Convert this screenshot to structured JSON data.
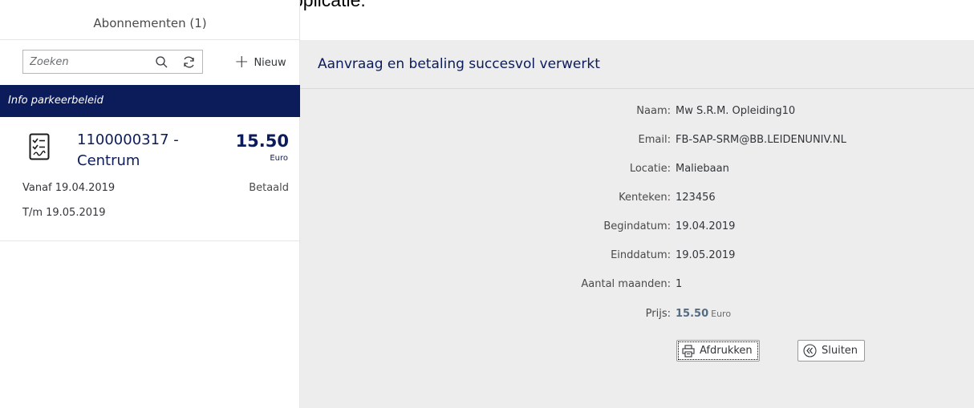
{
  "caption": "Na betaling komt men terug in de applicatie.",
  "master": {
    "title": "Abonnementen (1)",
    "search_placeholder": "Zoeken",
    "new_label": "Nieuw",
    "info_label": "Info parkeerbeleid",
    "items": [
      {
        "title_line1": "1100000317 -",
        "title_line2": "Centrum",
        "amount": "15.50",
        "unit": "Euro",
        "from": "Vanaf 19.04.2019",
        "to": "T/m 19.05.2019",
        "status": "Betaald"
      }
    ]
  },
  "detail": {
    "title": "Aanvraag en betaling succesvol verwerkt",
    "fields": [
      {
        "label": "Naam:",
        "value": "Mw S.R.M. Opleiding10"
      },
      {
        "label": "Email:",
        "value": "FB-SAP-SRM@BB.LEIDENUNIV.NL"
      },
      {
        "label": "Locatie:",
        "value": "Maliebaan"
      },
      {
        "label": "Kenteken:",
        "value": "123456"
      },
      {
        "label": "Begindatum:",
        "value": "19.04.2019"
      },
      {
        "label": "Einddatum:",
        "value": "19.05.2019"
      },
      {
        "label": "Aantal maanden:",
        "value": "1"
      }
    ],
    "price_label": "Prijs:",
    "price_value": "15.50",
    "price_unit": "Euro",
    "print_label": "Afdrukken",
    "close_label": "Sluiten"
  },
  "colors": {
    "brand_navy": "#0c1c5b",
    "detail_background": "#ededed"
  }
}
